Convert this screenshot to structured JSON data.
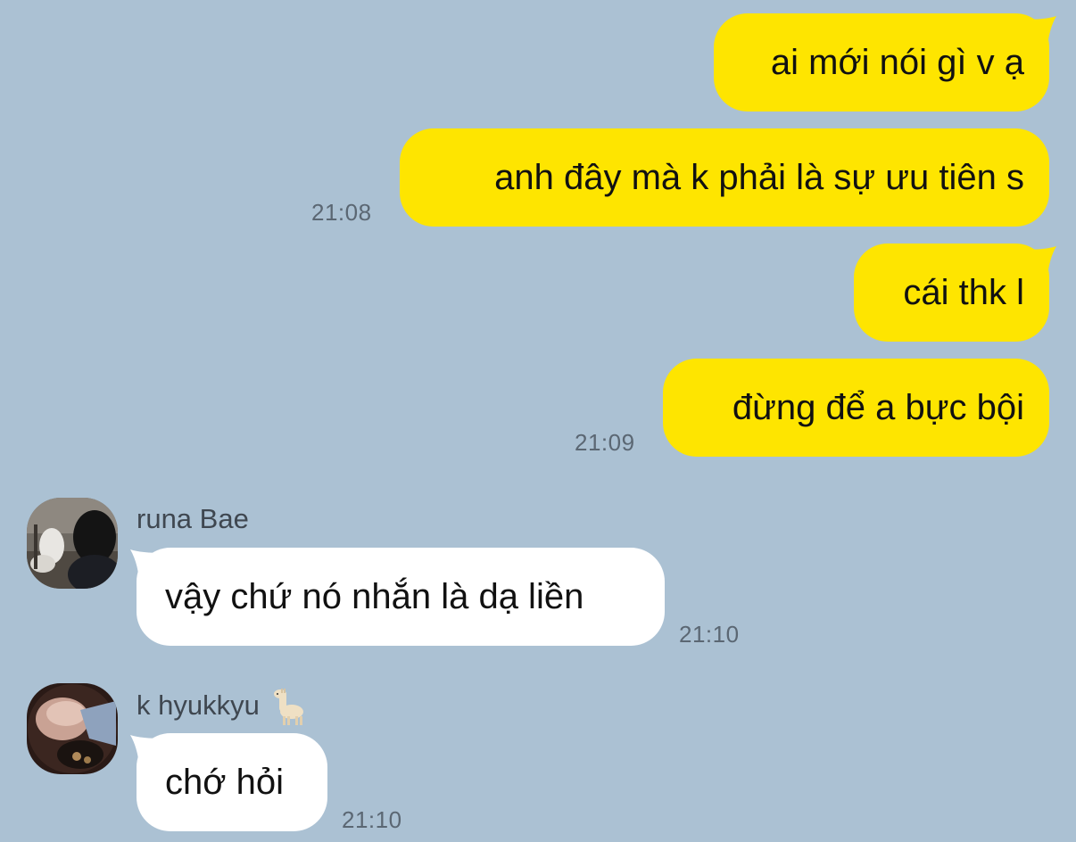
{
  "colors": {
    "background": "#abc1d3",
    "outgoing_bubble": "#fee500",
    "incoming_bubble": "#ffffff",
    "timestamp": "#5b6773"
  },
  "messages": {
    "out_1": {
      "text": "ai mới nói gì v ạ"
    },
    "out_2": {
      "text": "anh đây mà k phải là sự ưu tiên s",
      "time": "21:08"
    },
    "out_3": {
      "text": "cái thk l"
    },
    "out_4": {
      "text": "đừng để a bực bội",
      "time": "21:09"
    },
    "in_1": {
      "sender": "runa Bae",
      "text": "vậy chứ nó nhắn là dạ liền",
      "time": "21:10",
      "avatar_icon": "avatar-photo"
    },
    "in_2": {
      "sender": "k hyukkyu",
      "sender_emoji_icon": "llama-icon",
      "text": "chớ hỏi",
      "time": "21:10",
      "avatar_icon": "avatar-photo"
    }
  }
}
